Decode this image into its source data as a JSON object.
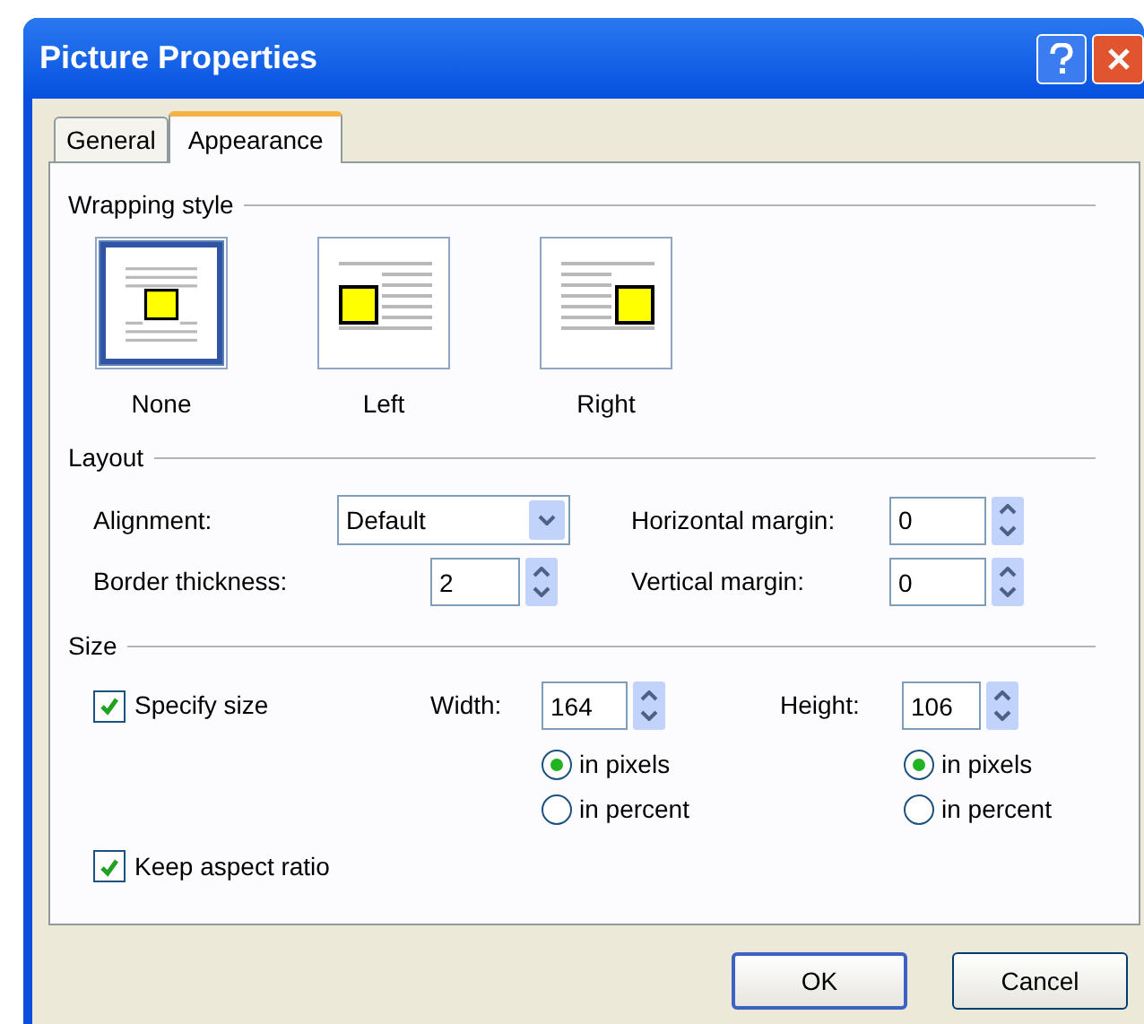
{
  "window": {
    "title": "Picture Properties"
  },
  "tabs": [
    {
      "label": "General",
      "selected": false
    },
    {
      "label": "Appearance",
      "selected": true
    }
  ],
  "wrapping_style": {
    "heading": "Wrapping style",
    "options": [
      {
        "label": "None",
        "kind": "none",
        "selected": true
      },
      {
        "label": "Left",
        "kind": "left",
        "selected": false
      },
      {
        "label": "Right",
        "kind": "right",
        "selected": false
      }
    ]
  },
  "layout": {
    "heading": "Layout",
    "alignment": {
      "label": "Alignment:",
      "value": "Default"
    },
    "border_thickness": {
      "label": "Border thickness:",
      "value": "2"
    },
    "horizontal_margin": {
      "label": "Horizontal margin:",
      "value": "0"
    },
    "vertical_margin": {
      "label": "Vertical margin:",
      "value": "0"
    }
  },
  "size": {
    "heading": "Size",
    "specify_size": {
      "label": "Specify size",
      "checked": true
    },
    "width": {
      "label": "Width:",
      "value": "164",
      "units": [
        {
          "label": "in pixels",
          "selected": true
        },
        {
          "label": "in percent",
          "selected": false
        }
      ]
    },
    "height": {
      "label": "Height:",
      "value": "106",
      "units": [
        {
          "label": "in pixels",
          "selected": true
        },
        {
          "label": "in percent",
          "selected": false
        }
      ]
    },
    "keep_aspect_ratio": {
      "label": "Keep aspect ratio",
      "checked": true
    }
  },
  "buttons": [
    {
      "label": "OK",
      "default": true
    },
    {
      "label": "Cancel",
      "default": false
    }
  ]
}
